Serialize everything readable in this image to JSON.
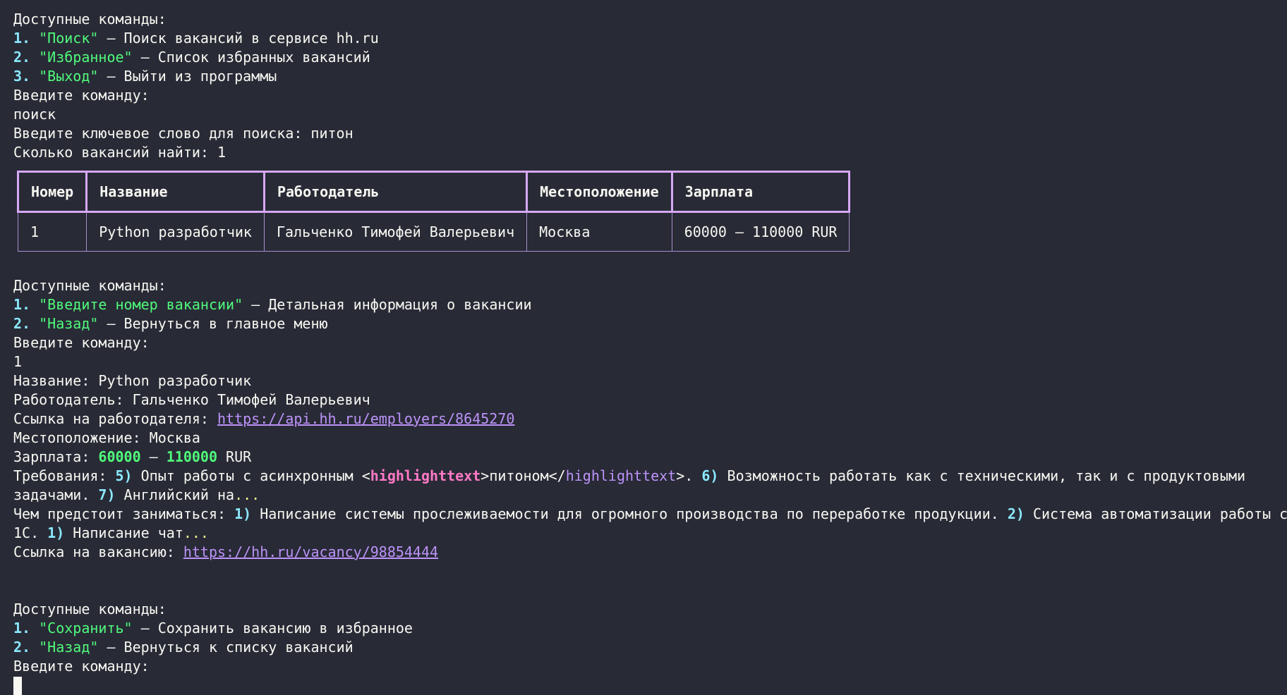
{
  "menu1": {
    "title": "Доступные команды:",
    "items": [
      {
        "num": "1.",
        "cmd": "\"Поиск\"",
        "desc": " – Поиск вакансий в сервисе hh.ru"
      },
      {
        "num": "2.",
        "cmd": "\"Избранное\"",
        "desc": " – Список избранных вакансий"
      },
      {
        "num": "3.",
        "cmd": "\"Выход\"",
        "desc": " – Выйти из программы"
      }
    ],
    "prompt": "Введите команду:",
    "input": "поиск"
  },
  "search": {
    "keyword_line": "Введите ключевое слово для поиска: питон",
    "count_line": "Сколько вакансий найти: 1"
  },
  "table": {
    "headers": [
      "Номер",
      "Название",
      "Работодатель",
      "Местоположение",
      "Зарплата"
    ],
    "rows": [
      [
        "1",
        "Python разработчик",
        "Гальченко Тимофей Валерьевич",
        "Москва",
        "60000 – 110000 RUR"
      ]
    ]
  },
  "menu2": {
    "title": "Доступные команды:",
    "items": [
      {
        "num": "1.",
        "cmd": "\"Введите номер вакансии\"",
        "desc": " – Детальная информация о вакансии"
      },
      {
        "num": "2.",
        "cmd": "\"Назад\"",
        "desc": " – Вернуться в главное меню"
      }
    ],
    "prompt": "Введите команду:",
    "input": "1"
  },
  "detail": {
    "name_line": "Название: Python разработчик",
    "employer_line": "Работодатель: Гальченко Тимофей Валерьевич",
    "employer_link_label": "Ссылка на работодателя: ",
    "employer_link": "https://api.hh.ru/employers/8645270",
    "location_line": "Местоположение: Москва",
    "salary_label": "Зарплата: ",
    "salary_from": "60000",
    "salary_dash": " – ",
    "salary_to": "110000",
    "salary_currency": " RUR",
    "req_label": "Требования: ",
    "req_n5": "5)",
    "req_t1": " Опыт работы с асинхронным ",
    "req_tag_open_lt": "<",
    "req_tag_open_name": "highlighttext",
    "req_tag_open_gt": ">питоном</",
    "req_tag_close_name": "highlighttext",
    "req_tag_close_gt": ">. ",
    "req_n6": "6)",
    "req_t2": " Возможность работать как с техническими, так и с продуктовыми",
    "req_t3": "задачами. ",
    "req_n7": "7)",
    "req_t4": " Английский на",
    "req_ellipsis": "...",
    "resp_label": "Чем предстоит заниматься: ",
    "resp_n1": "1)",
    "resp_t1": " Написание системы прослеживаемости для огромного производства по переработке продукции. ",
    "resp_n2": "2)",
    "resp_t2": " Система автоматизации работы с",
    "resp_t3": "1С. ",
    "resp_n3": "1)",
    "resp_t4": " Написание чат",
    "resp_ellipsis": "...",
    "vacancy_link_label": "Ссылка на вакансию: ",
    "vacancy_link": "https://hh.ru/vacancy/98854444"
  },
  "menu3": {
    "title": "Доступные команды:",
    "items": [
      {
        "num": "1.",
        "cmd": "\"Сохранить\"",
        "desc": " – Сохранить вакансию в избранное"
      },
      {
        "num": "2.",
        "cmd": "\"Назад\"",
        "desc": " – Вернуться к списку вакансий"
      }
    ],
    "prompt": "Введите команду:"
  },
  "colors": {
    "background": "#282a36",
    "foreground": "#f8f8f2",
    "number": "#8be9fd",
    "command": "#50fa7b",
    "tag": "#ff79c6",
    "link": "#bd93f9",
    "ellipsis": "#f1fa8c",
    "table_border": "#d6a8f5"
  }
}
